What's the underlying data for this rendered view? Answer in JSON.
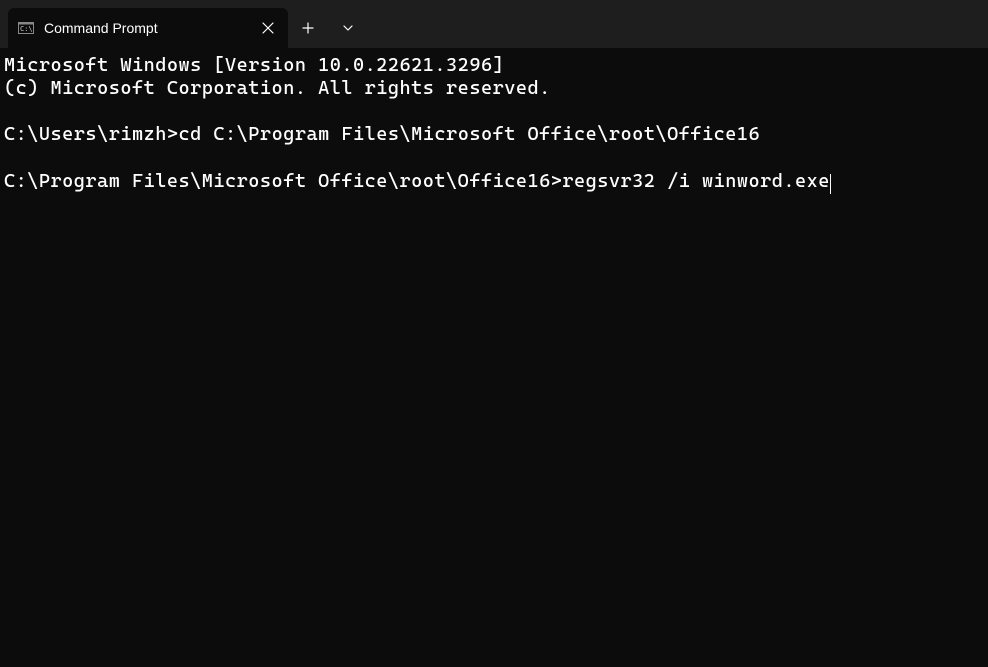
{
  "tab": {
    "title": "Command Prompt"
  },
  "terminal": {
    "line1": "Microsoft Windows [Version 10.0.22621.3296]",
    "line2": "(c) Microsoft Corporation. All rights reserved.",
    "prompt1": "C:\\Users\\rimzh>",
    "command1": "cd C:\\Program Files\\Microsoft Office\\root\\Office16",
    "prompt2": "C:\\Program Files\\Microsoft Office\\root\\Office16>",
    "command2": "regsvr32 /i winword.exe"
  }
}
